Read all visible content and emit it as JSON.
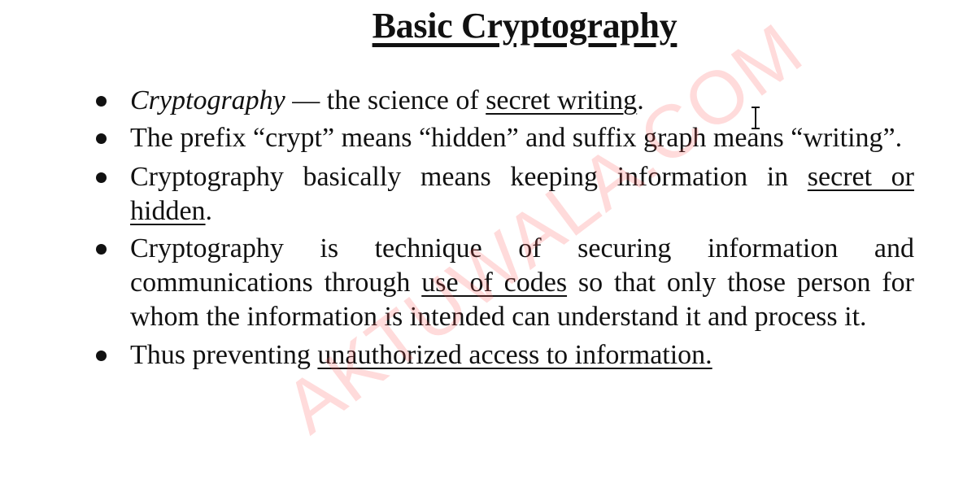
{
  "slide": {
    "title": "Basic Cryptography",
    "watermark": "AKTUWALA.COM",
    "bullets": [
      {
        "parts": [
          {
            "text": "Cryptography",
            "style": "italic"
          },
          {
            "text": " — the science of ",
            "style": "normal"
          },
          {
            "text": "secret writing",
            "style": "underline"
          },
          {
            "text": ".",
            "style": "normal"
          }
        ]
      },
      {
        "parts": [
          {
            "text": "The prefix “crypt” means “hidden” and suffix graph means “writing”.",
            "style": "normal"
          }
        ]
      },
      {
        "parts": [
          {
            "text": "Cryptography basically means keeping information in ",
            "style": "normal"
          },
          {
            "text": "secret or hidden",
            "style": "underline"
          },
          {
            "text": ".",
            "style": "normal"
          }
        ]
      },
      {
        "parts": [
          {
            "text": "Cryptography is technique of securing information and communications through ",
            "style": "normal"
          },
          {
            "text": "use of codes",
            "style": "underline"
          },
          {
            "text": " so that only those person for whom the information is intended can understand it and process it.",
            "style": "normal"
          }
        ]
      },
      {
        "parts": [
          {
            "text": "Thus preventing ",
            "style": "normal"
          },
          {
            "text": "unauthorized access to information.",
            "style": "underline"
          }
        ]
      }
    ]
  },
  "cursor": {
    "icon": "text-cursor-icon"
  },
  "colors": {
    "text": "#111111",
    "background": "#ffffff",
    "watermark": "#ff5a5a"
  }
}
